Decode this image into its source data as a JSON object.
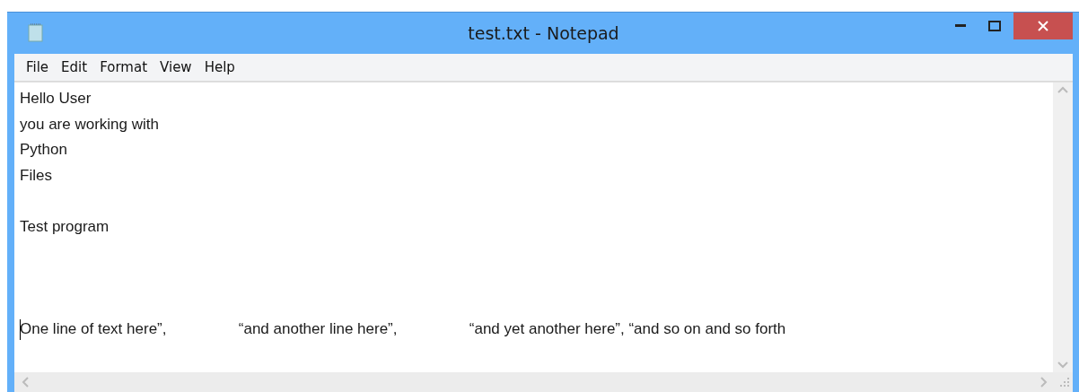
{
  "window": {
    "title": "test.txt - Notepad"
  },
  "menu": [
    "File",
    "Edit",
    "Format",
    "View",
    "Help"
  ],
  "editor": {
    "lines": [
      {
        "kind": "text",
        "text": "Hello User",
        "caret": false
      },
      {
        "kind": "text",
        "text": "you are working with",
        "caret": false
      },
      {
        "kind": "text",
        "text": "Python",
        "caret": false
      },
      {
        "kind": "text",
        "text": "Files",
        "caret": false
      },
      {
        "kind": "blank"
      },
      {
        "kind": "text",
        "text": "Test program",
        "caret": false
      },
      {
        "kind": "blank"
      },
      {
        "kind": "blank"
      },
      {
        "kind": "blank"
      },
      {
        "kind": "text",
        "text": "One line of text here”,                 “and another line here”,                 “and yet another here”, “and so on and so forth",
        "caret": true
      }
    ]
  }
}
